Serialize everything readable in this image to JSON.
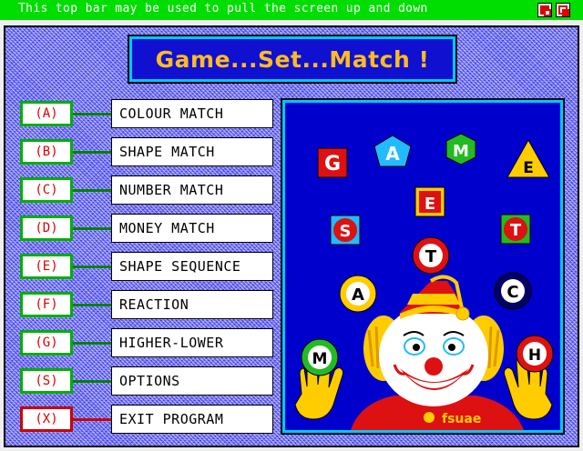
{
  "titlebar": {
    "text": "This top bar may be used to pull the screen up and down"
  },
  "app": {
    "title": "Game...Set...Match !"
  },
  "menu": [
    {
      "key": "(A)",
      "label": "COLOUR MATCH"
    },
    {
      "key": "(B)",
      "label": "SHAPE MATCH"
    },
    {
      "key": "(C)",
      "label": "NUMBER MATCH"
    },
    {
      "key": "(D)",
      "label": "MONEY MATCH"
    },
    {
      "key": "(E)",
      "label": "SHAPE SEQUENCE"
    },
    {
      "key": "(F)",
      "label": "REACTION"
    },
    {
      "key": "(G)",
      "label": "HIGHER-LOWER"
    },
    {
      "key": "(S)",
      "label": "OPTIONS"
    },
    {
      "key": "(X)",
      "label": "EXIT PROGRAM"
    }
  ],
  "illustration": {
    "letters": {
      "g": "G",
      "a1": "A",
      "m1": "M",
      "e1": "E",
      "e2": "E",
      "s": "S",
      "t1": "T",
      "t2": "T",
      "a2": "A",
      "c": "C",
      "m2": "M",
      "h": "H"
    },
    "credit": "fsuae"
  },
  "colors": {
    "titlebar": "#00dd00",
    "title_text": "#ffbb22",
    "panel_bg": "#0000cc",
    "key_border": "#00b000",
    "exit_border": "#cc0000"
  }
}
